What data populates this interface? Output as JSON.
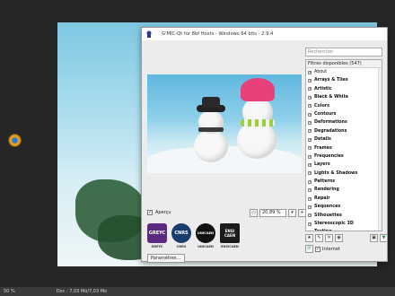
{
  "gmic": {
    "title": "G'MIC-Qt for 8bf Hosts - Windows 64 bits - 2.9.4",
    "preview_label": "Aperçu",
    "zoom_value": "20,89 %",
    "params_button": "Paramètres...",
    "search_placeholder": "Rechercher",
    "filter_header": "Filtres disponibles (547)",
    "filters": [
      "About",
      "Arrays & Tiles",
      "Artistic",
      "Black & White",
      "Colors",
      "Contours",
      "Deformations",
      "Degradations",
      "Details",
      "Frames",
      "Frequencies",
      "Layers",
      "Lights & Shadows",
      "Patterns",
      "Rendering",
      "Repair",
      "Sequences",
      "Silhouettes",
      "Stereoscopic 3D",
      "Testing"
    ],
    "internet_label": "Internet",
    "logos": [
      {
        "name": "GREYC",
        "caption": "GREYC",
        "color": "#5b2a7e"
      },
      {
        "name": "CNRS",
        "caption": "CNRS",
        "color": "#1a3b6e"
      },
      {
        "name": "UNICAEN",
        "caption": "UNICAEN",
        "color": "#111111"
      },
      {
        "name": "ENSI CAEN",
        "caption": "ENSICAEN",
        "color": "#1b1b1b"
      }
    ]
  },
  "statusbar": {
    "zoom": "50 %",
    "doc": "Doc : 7,03 Mo/7,03 Mo"
  }
}
